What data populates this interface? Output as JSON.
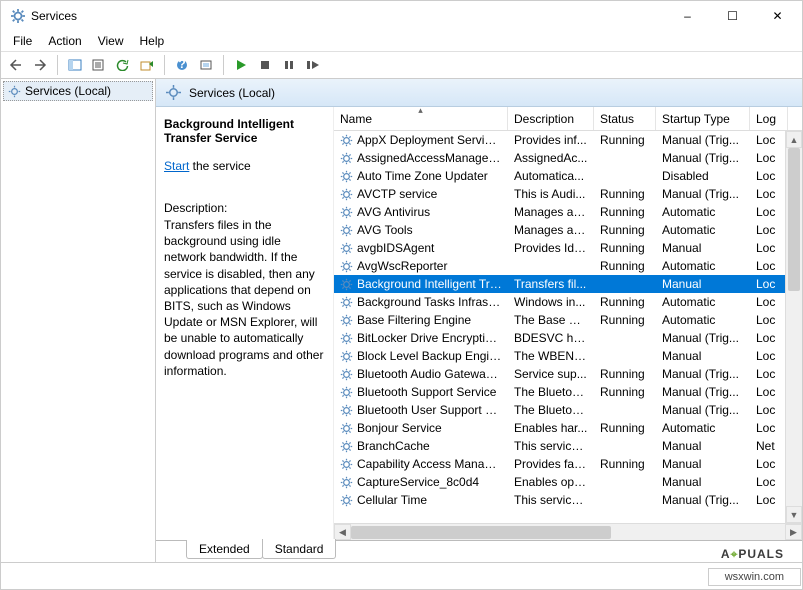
{
  "window": {
    "title": "Services",
    "controls": {
      "min": "–",
      "max": "☐",
      "close": "✕"
    }
  },
  "menu": [
    "File",
    "Action",
    "View",
    "Help"
  ],
  "tree": {
    "root": "Services (Local)"
  },
  "header": {
    "title": "Services (Local)"
  },
  "detail": {
    "name": "Background Intelligent Transfer Service",
    "start_label": "Start",
    "start_suffix": " the service",
    "desc_label": "Description:",
    "description": "Transfers files in the background using idle network bandwidth. If the service is disabled, then any applications that depend on BITS, such as Windows Update or MSN Explorer, will be unable to automatically download programs and other information."
  },
  "columns": {
    "name": "Name",
    "description": "Description",
    "status": "Status",
    "startup": "Startup Type",
    "logon": "Log"
  },
  "services": [
    {
      "name": "AppX Deployment Service (...",
      "desc": "Provides inf...",
      "status": "Running",
      "type": "Manual (Trig...",
      "log": "Loc",
      "sel": false
    },
    {
      "name": "AssignedAccessManager Se...",
      "desc": "AssignedAc...",
      "status": "",
      "type": "Manual (Trig...",
      "log": "Loc",
      "sel": false
    },
    {
      "name": "Auto Time Zone Updater",
      "desc": "Automatica...",
      "status": "",
      "type": "Disabled",
      "log": "Loc",
      "sel": false
    },
    {
      "name": "AVCTP service",
      "desc": "This is Audi...",
      "status": "Running",
      "type": "Manual (Trig...",
      "log": "Loc",
      "sel": false
    },
    {
      "name": "AVG Antivirus",
      "desc": "Manages an...",
      "status": "Running",
      "type": "Automatic",
      "log": "Loc",
      "sel": false
    },
    {
      "name": "AVG Tools",
      "desc": "Manages an...",
      "status": "Running",
      "type": "Automatic",
      "log": "Loc",
      "sel": false
    },
    {
      "name": "avgbIDSAgent",
      "desc": "Provides Ide...",
      "status": "Running",
      "type": "Manual",
      "log": "Loc",
      "sel": false
    },
    {
      "name": "AvgWscReporter",
      "desc": "",
      "status": "Running",
      "type": "Automatic",
      "log": "Loc",
      "sel": false
    },
    {
      "name": "Background Intelligent Tran...",
      "desc": "Transfers fil...",
      "status": "",
      "type": "Manual",
      "log": "Loc",
      "sel": true
    },
    {
      "name": "Background Tasks Infrastruc...",
      "desc": "Windows in...",
      "status": "Running",
      "type": "Automatic",
      "log": "Loc",
      "sel": false
    },
    {
      "name": "Base Filtering Engine",
      "desc": "The Base Fil...",
      "status": "Running",
      "type": "Automatic",
      "log": "Loc",
      "sel": false
    },
    {
      "name": "BitLocker Drive Encryption ...",
      "desc": "BDESVC hos...",
      "status": "",
      "type": "Manual (Trig...",
      "log": "Loc",
      "sel": false
    },
    {
      "name": "Block Level Backup Engine ...",
      "desc": "The WBENG...",
      "status": "",
      "type": "Manual",
      "log": "Loc",
      "sel": false
    },
    {
      "name": "Bluetooth Audio Gateway S...",
      "desc": "Service sup...",
      "status": "Running",
      "type": "Manual (Trig...",
      "log": "Loc",
      "sel": false
    },
    {
      "name": "Bluetooth Support Service",
      "desc": "The Bluetoo...",
      "status": "Running",
      "type": "Manual (Trig...",
      "log": "Loc",
      "sel": false
    },
    {
      "name": "Bluetooth User Support Ser...",
      "desc": "The Bluetoo...",
      "status": "",
      "type": "Manual (Trig...",
      "log": "Loc",
      "sel": false
    },
    {
      "name": "Bonjour Service",
      "desc": "Enables har...",
      "status": "Running",
      "type": "Automatic",
      "log": "Loc",
      "sel": false
    },
    {
      "name": "BranchCache",
      "desc": "This service ...",
      "status": "",
      "type": "Manual",
      "log": "Net",
      "sel": false
    },
    {
      "name": "Capability Access Manager ...",
      "desc": "Provides fac...",
      "status": "Running",
      "type": "Manual",
      "log": "Loc",
      "sel": false
    },
    {
      "name": "CaptureService_8c0d4",
      "desc": "Enables opti...",
      "status": "",
      "type": "Manual",
      "log": "Loc",
      "sel": false
    },
    {
      "name": "Cellular Time",
      "desc": "This service ...",
      "status": "",
      "type": "Manual (Trig...",
      "log": "Loc",
      "sel": false
    }
  ],
  "tabs": {
    "extended": "Extended",
    "standard": "Standard"
  },
  "status_bar": "wsxwin.com",
  "watermark": {
    "pre": "A",
    "mid": "⌖",
    "post": "PUALS"
  }
}
